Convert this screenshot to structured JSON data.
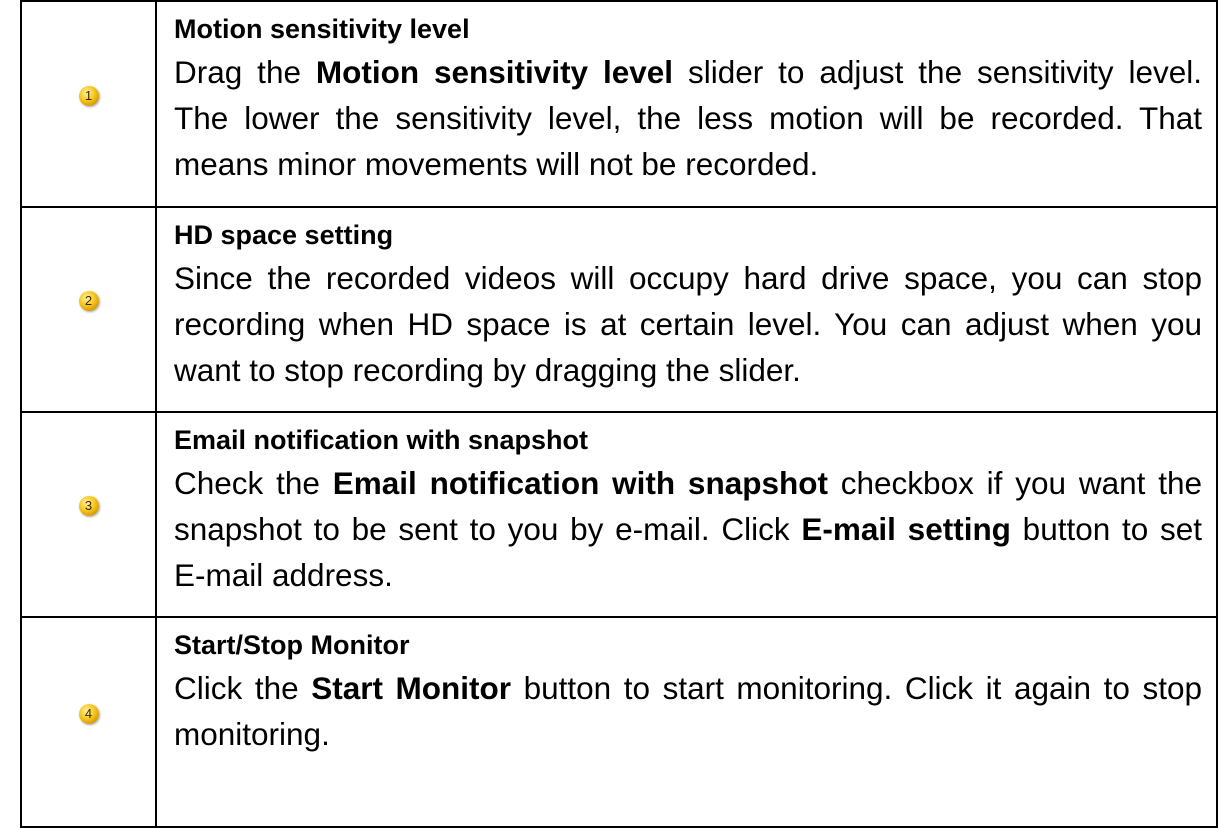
{
  "rows": [
    {
      "badge": "1",
      "title": "Motion sensitivity level",
      "desc": {
        "t1": "Drag the ",
        "b1": "Motion sensitivity level",
        "t2": " slider to adjust the sensitivity level. The lower the sensitivity level, the less motion will be recorded. That means minor movements will not be recorded."
      }
    },
    {
      "badge": "2",
      "title": "HD space setting",
      "desc": {
        "t1": "Since the recorded videos will occupy hard drive space, you can stop recording when HD space is at certain level. You can adjust when you want to stop recording by dragging the slider."
      }
    },
    {
      "badge": "3",
      "title": "Email notification with snapshot",
      "desc": {
        "t1": "Check the ",
        "b1": "Email notification with snapshot",
        "t2": " checkbox if you want the snapshot to be sent to you by e-mail. Click ",
        "b2": "E-mail setting",
        "t3": " button to set E-mail address."
      }
    },
    {
      "badge": "4",
      "title": "Start/Stop Monitor",
      "desc": {
        "t1": "Click the ",
        "b1": "Start Monitor",
        "t2": " button to start monitoring. Click it again to stop monitoring."
      }
    }
  ]
}
